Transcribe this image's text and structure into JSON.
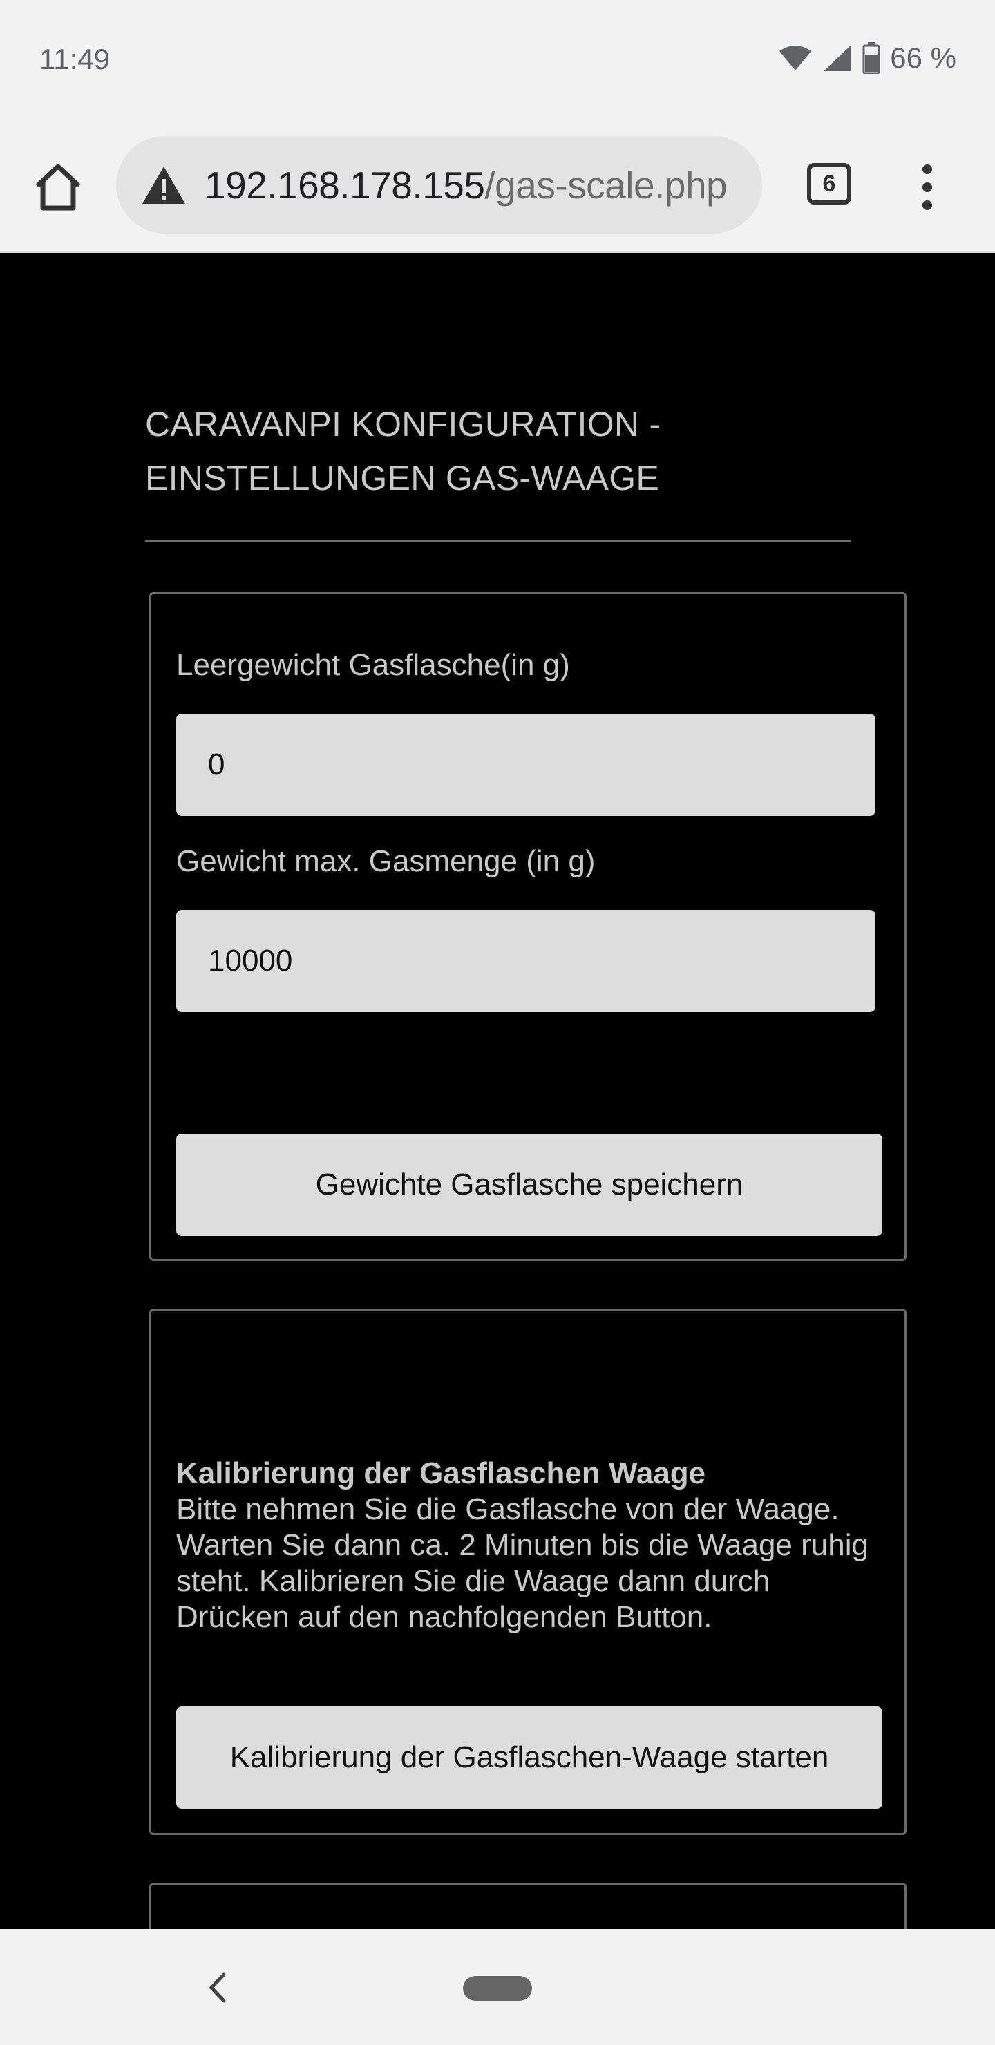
{
  "status": {
    "time": "11:49",
    "battery": "66 %"
  },
  "browser": {
    "url_host": "192.168.178.155",
    "url_path": "/gas-scale.php",
    "tab_count": "6"
  },
  "page": {
    "title_line1": "CARAVANPI KONFIGURATION -",
    "title_line2": "EINSTELLUNGEN GAS-WAAGE"
  },
  "weights_form": {
    "empty_label": "Leergewicht Gasflasche(in g)",
    "empty_value": "0",
    "max_label": "Gewicht max. Gasmenge (in g)",
    "max_value": "10000",
    "save_button": "Gewichte Gasflasche speichern"
  },
  "calibration": {
    "heading": "Kalibrierung der Gasflaschen Waage",
    "text": "Bitte nehmen Sie die Gasflasche von der Waage. Warten Sie dann ca. 2 Minuten bis die Waage ruhig steht. Kalibrieren Sie die Waage dann durch Drücken auf den nachfolgenden Button.",
    "button": "Kalibrierung der Gasflaschen-Waage starten"
  },
  "colors": {
    "page_background": "#000000",
    "input_background": "#dcdcdc",
    "text_light": "#c8c8c8"
  }
}
